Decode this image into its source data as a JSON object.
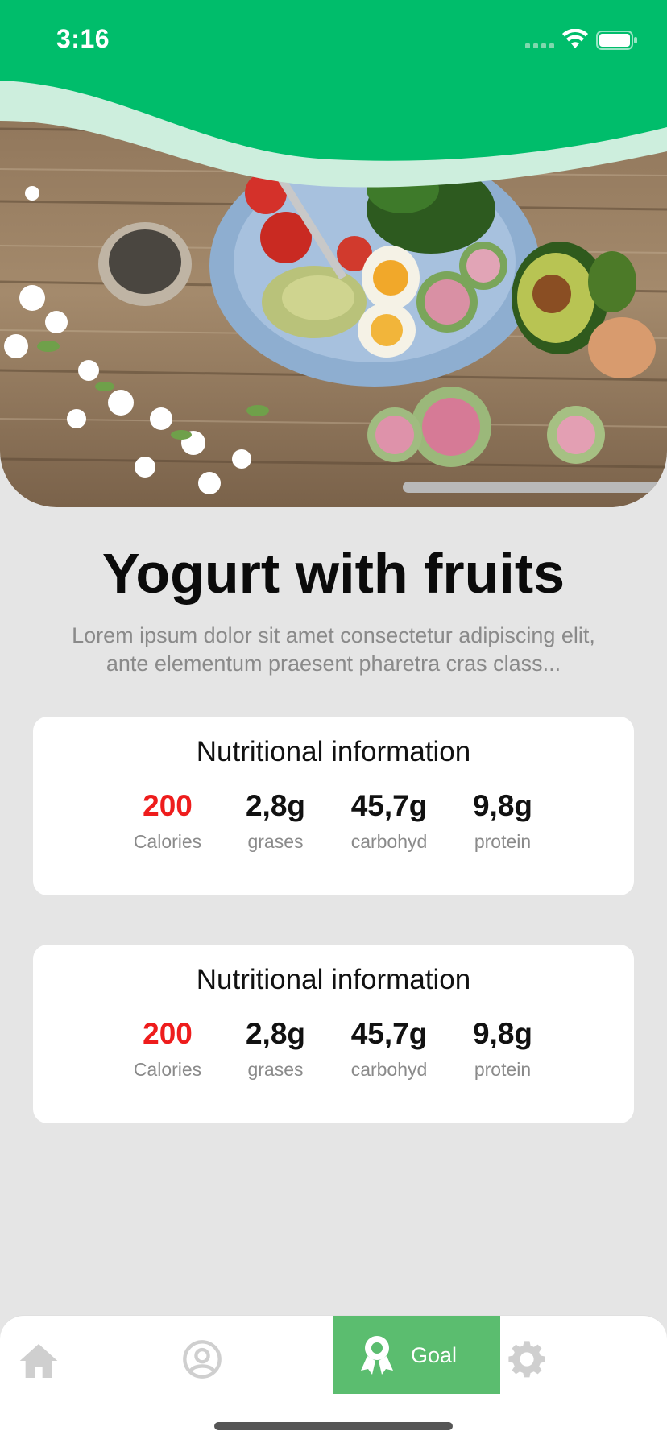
{
  "status_bar": {
    "time": "3:16"
  },
  "recipe": {
    "title": "Yogurt with fruits",
    "description": "Lorem ipsum dolor sit amet consectetur adipiscing elit, ante elementum praesent pharetra cras class..."
  },
  "cards": [
    {
      "title": "Nutritional information",
      "stats": [
        {
          "value": "200",
          "label": "Calories"
        },
        {
          "value": "2,8g",
          "label": "grases"
        },
        {
          "value": "45,7g",
          "label": "carbohyd"
        },
        {
          "value": "9,8g",
          "label": "protein"
        }
      ]
    },
    {
      "title": "Nutritional information",
      "stats": [
        {
          "value": "200",
          "label": "Calories"
        },
        {
          "value": "2,8g",
          "label": "grases"
        },
        {
          "value": "45,7g",
          "label": "carbohyd"
        },
        {
          "value": "9,8g",
          "label": "protein"
        }
      ]
    }
  ],
  "tabbar": {
    "items": [
      {
        "icon": "home-icon"
      },
      {
        "icon": "profile-icon"
      },
      {
        "icon": "goal-icon",
        "label": "Goal",
        "active": true
      },
      {
        "icon": "settings-icon"
      }
    ]
  },
  "colors": {
    "header_green": "#00bd6b",
    "accent_red": "#ee1c1c",
    "active_tab": "#5bbd6f"
  }
}
